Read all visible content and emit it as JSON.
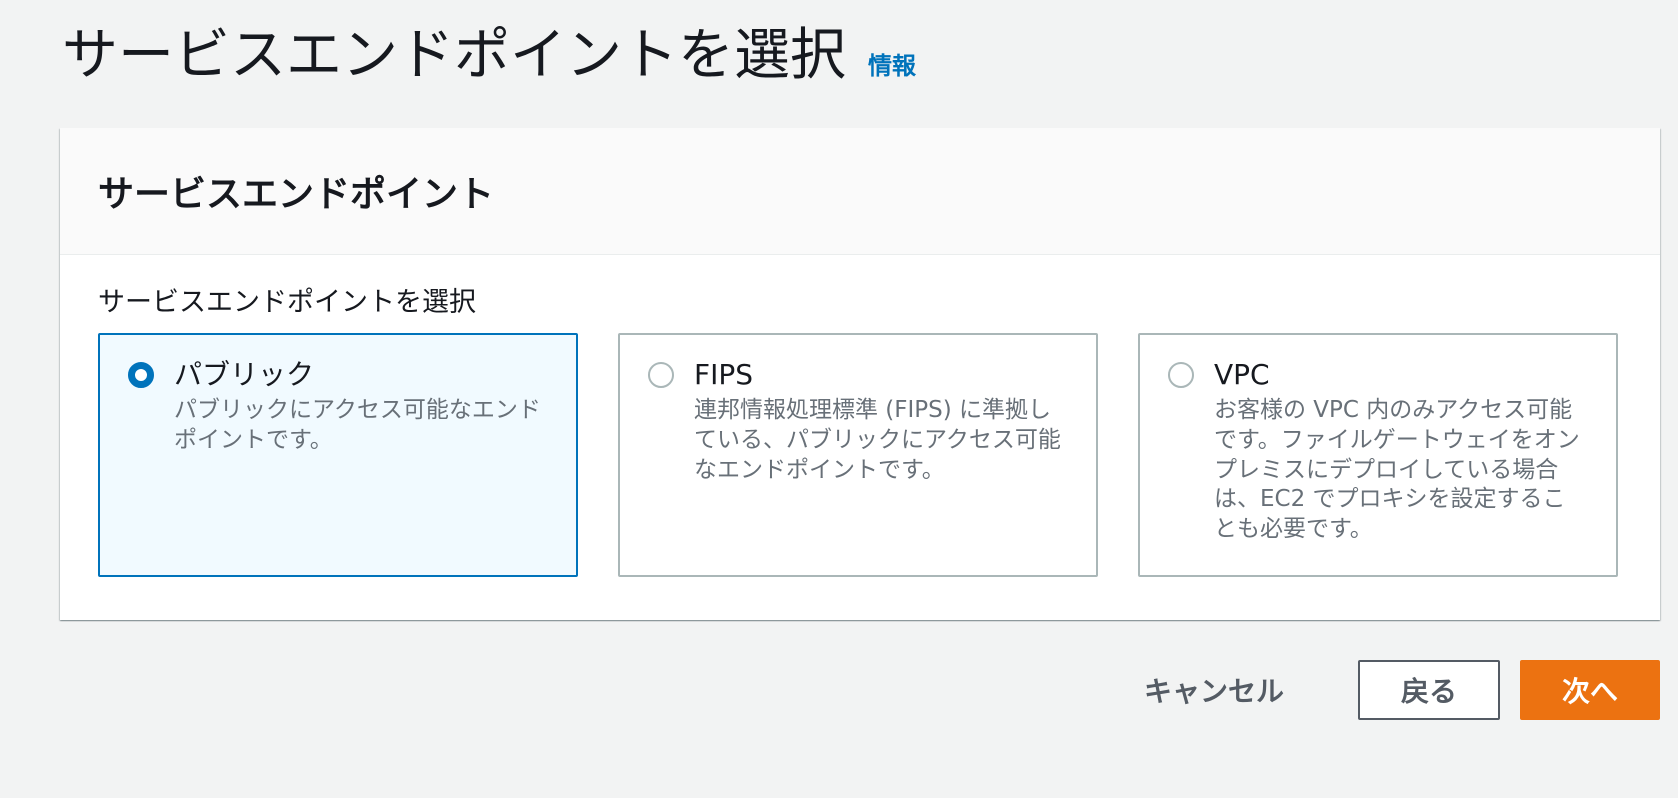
{
  "header": {
    "title": "サービスエンドポイントを選択",
    "info_link": "情報"
  },
  "panel": {
    "title": "サービスエンドポイント",
    "field_label": "サービスエンドポイントを選択",
    "options": [
      {
        "label": "パブリック",
        "description": "パブリックにアクセス可能なエンドポイントです。",
        "selected": true
      },
      {
        "label": "FIPS",
        "description": "連邦情報処理標準 (FIPS) に準拠している、パブリックにアクセス可能なエンドポイントです。",
        "selected": false
      },
      {
        "label": "VPC",
        "description": "お客様の VPC 内のみアクセス可能です。ファイルゲートウェイをオンプレミスにデプロイしている場合は、EC2 でプロキシを設定することも必要です。",
        "selected": false
      }
    ]
  },
  "actions": {
    "cancel_label": "キャンセル",
    "back_label": "戻る",
    "next_label": "次へ"
  },
  "colors": {
    "accent": "#0073bb",
    "primary_button": "#ec7211",
    "background": "#f2f3f3"
  }
}
